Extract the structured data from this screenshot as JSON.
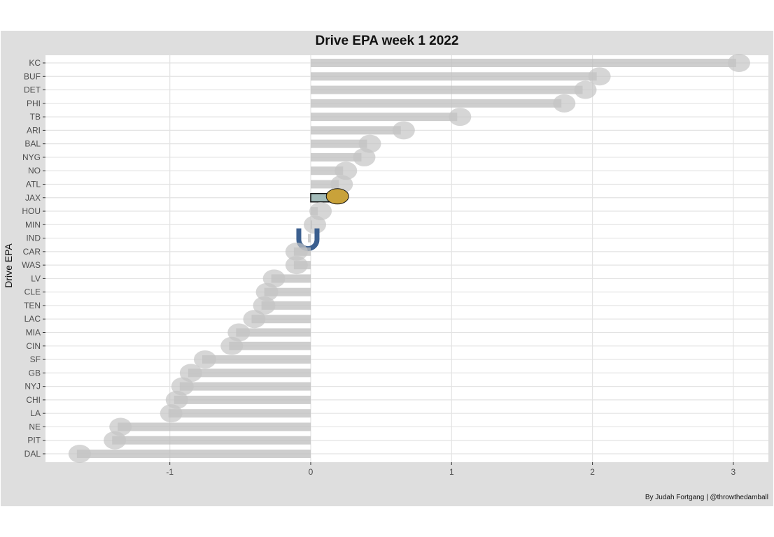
{
  "chart_data": {
    "type": "bar",
    "orientation": "horizontal",
    "title": "Drive EPA week 1 2022",
    "xlabel": "",
    "ylabel": "Drive EPA",
    "caption": "By Judah Fortgang | @throwthedamball",
    "xlim": [
      -1.8,
      3.25
    ],
    "xticks": [
      -1,
      0,
      1,
      2,
      3
    ],
    "xtick_labels": [
      "-1",
      "0",
      "1",
      "2",
      "3"
    ],
    "grid": true,
    "highlight": {
      "team": "JAX",
      "fill": "#a3bbb9",
      "stroke": "#111111"
    },
    "highlight_logo": {
      "team": "IND",
      "color": "#3b5f8f"
    },
    "bar_color": "#bdbdbd",
    "categories": [
      "KC",
      "BUF",
      "DET",
      "PHI",
      "TB",
      "ARI",
      "BAL",
      "NYG",
      "NO",
      "ATL",
      "JAX",
      "HOU",
      "MIN",
      "IND",
      "CAR",
      "WAS",
      "LV",
      "CLE",
      "TEN",
      "LAC",
      "MIA",
      "CIN",
      "SF",
      "GB",
      "NYJ",
      "CHI",
      "LA",
      "NE",
      "PIT",
      "DAL"
    ],
    "values": [
      3.02,
      2.03,
      1.93,
      1.78,
      1.04,
      0.64,
      0.4,
      0.36,
      0.23,
      0.2,
      0.16,
      0.05,
      0.01,
      -0.02,
      -0.12,
      -0.12,
      -0.28,
      -0.33,
      -0.35,
      -0.42,
      -0.53,
      -0.58,
      -0.77,
      -0.87,
      -0.93,
      -0.97,
      -1.01,
      -1.37,
      -1.41,
      -1.66
    ]
  }
}
